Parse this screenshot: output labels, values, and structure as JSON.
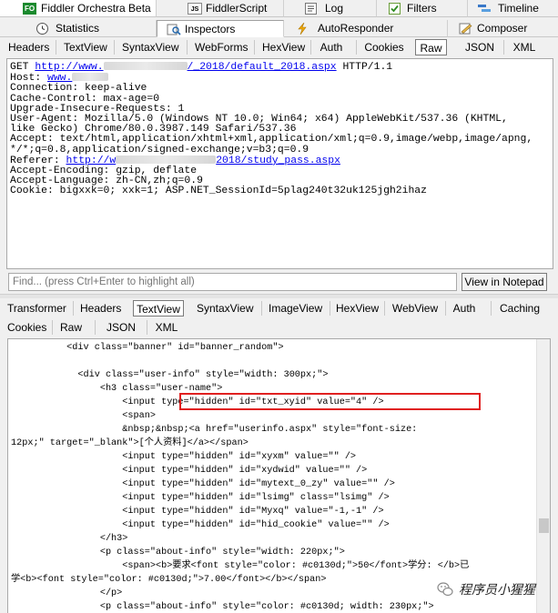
{
  "top_tabs_row1": [
    {
      "label": "Fiddler Orchestra Beta",
      "icon": "fiddler-orchestra-icon",
      "badge": "FO"
    },
    {
      "label": "FiddlerScript",
      "icon": "script-js-icon",
      "badge": "JS"
    },
    {
      "label": "Log",
      "icon": "log-icon"
    },
    {
      "label": "Filters",
      "icon": "checkbox-icon"
    },
    {
      "label": "Timeline",
      "icon": "timeline-icon"
    }
  ],
  "top_tabs_row2": [
    {
      "label": "Statistics",
      "icon": "stopwatch-icon"
    },
    {
      "label": "Inspectors",
      "icon": "inspectors-icon"
    },
    {
      "label": "AutoResponder",
      "icon": "lightning-icon"
    },
    {
      "label": "Composer",
      "icon": "composer-icon"
    }
  ],
  "request_tabs": [
    "Headers",
    "TextView",
    "SyntaxView",
    "WebForms",
    "HexView",
    "Auth",
    "Cookies",
    "Raw",
    "JSON",
    "XML"
  ],
  "request_active_tab": "Raw",
  "request": {
    "method": "GET ",
    "url_start": "http://www.",
    "url_end": "/_2018/default_2018.aspx",
    "protocol": " HTTP/1.1",
    "host_label": "Host: ",
    "host_value": "www.",
    "lines": [
      "Connection: keep-alive",
      "Cache-Control: max-age=0",
      "Upgrade-Insecure-Requests: 1",
      "User-Agent: Mozilla/5.0 (Windows NT 10.0; Win64; x64) AppleWebKit/537.36 (KHTML,",
      "like Gecko) Chrome/80.0.3987.149 Safari/537.36",
      "Accept: text/html,application/xhtml+xml,application/xml;q=0.9,image/webp,image/apng,",
      "*/*;q=0.8,application/signed-exchange;v=b3;q=0.9"
    ],
    "referer_label": "Referer: ",
    "referer_start": "http://w",
    "referer_end": "2018/study_pass.aspx",
    "lines2": [
      "Accept-Encoding: gzip, deflate",
      "Accept-Language: zh-CN,zh;q=0.9",
      "Cookie: bigxxk=0; xxk=1; ASP.NET_SessionId=5plag240t32uk125jgh2ihaz"
    ]
  },
  "find": {
    "placeholder": "Find... (press Ctrl+Enter to highlight all)",
    "button": "View in Notepad"
  },
  "response_tabs_row1": [
    "Transformer",
    "Headers",
    "TextView",
    "SyntaxView",
    "ImageView",
    "HexView",
    "WebView",
    "Auth",
    "Caching"
  ],
  "response_tabs_row2": [
    "Cookies",
    "Raw",
    "JSON",
    "XML"
  ],
  "response_active_tab": "TextView",
  "response_lines": [
    {
      "indent": "          ",
      "text": "<div class=\"banner\" id=\"banner_random\">"
    },
    {
      "indent": "",
      "text": ""
    },
    {
      "indent": "            ",
      "text": "<div class=\"user-info\" style=\"width: 300px;\">"
    },
    {
      "indent": "                ",
      "text": "<h3 class=\"user-name\">"
    },
    {
      "indent": "                    ",
      "text": "<input type=\"hidden\" id=\"txt_xyid\" value=\"4\" />"
    },
    {
      "indent": "                    ",
      "text": "<span>"
    },
    {
      "indent": "                    ",
      "text": "&nbsp;&nbsp;<a href=\"userinfo.aspx\" style=\"font-size:"
    },
    {
      "indent": "",
      "text": "12px;\" target=\"_blank\">[个人资料]</a></span>"
    },
    {
      "indent": "                    ",
      "text": "<input type=\"hidden\" id=\"xyxm\" value=\"\" />"
    },
    {
      "indent": "                    ",
      "text": "<input type=\"hidden\" id=\"xydwid\" value=\"\" />"
    },
    {
      "indent": "                    ",
      "text": "<input type=\"hidden\" id=\"mytext_0_zy\" value=\"\" />"
    },
    {
      "indent": "                    ",
      "text": "<input type=\"hidden\" id=\"lsimg\" class=\"lsimg\" />"
    },
    {
      "indent": "                    ",
      "text": "<input type=\"hidden\" id=\"Myxq\" value=\"-1,-1\" />"
    },
    {
      "indent": "                    ",
      "text": "<input type=\"hidden\" id=\"hid_cookie\" value=\"\" />"
    },
    {
      "indent": "                ",
      "text": "</h3>"
    },
    {
      "indent": "                ",
      "text": "<p class=\"about-info\" style=\"width: 220px;\">"
    },
    {
      "indent": "                    ",
      "text": "<span><b>要求<font style=\"color: #c0130d;\">50</font>学分: </b>已"
    },
    {
      "indent": "",
      "text": "学<b><font style=\"color: #c0130d;\">7.00</font></b></span>"
    },
    {
      "indent": "                ",
      "text": "</p>"
    },
    {
      "indent": "                ",
      "text": "<p class=\"about-info\" style=\"color: #c0130d; width: 230px;\">"
    }
  ],
  "watermark": "程序员小猩猩",
  "colors": {
    "highlight_box": "#e02020",
    "link": "#0000ee",
    "active_tab_border": "#7a7a7a"
  }
}
